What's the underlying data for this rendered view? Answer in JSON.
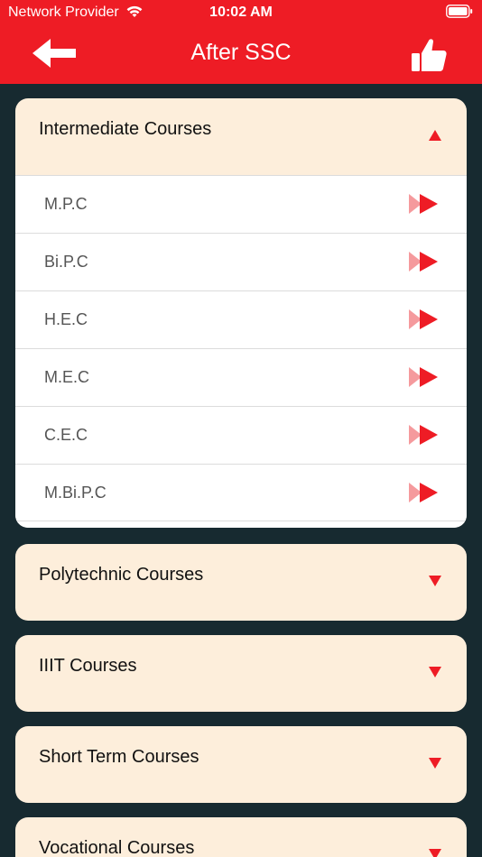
{
  "status_bar": {
    "carrier": "Network Provider",
    "time": "10:02 AM"
  },
  "nav": {
    "title": "After SSC",
    "back_icon": "back-arrow-icon",
    "like_icon": "thumbs-up-icon"
  },
  "colors": {
    "accent": "#ee1c25",
    "background": "#172a30",
    "card": "#fdeedb",
    "list": "#ffffff"
  },
  "sections": [
    {
      "title": "Intermediate Courses",
      "expanded": true,
      "items": [
        "M.P.C",
        "Bi.P.C",
        "H.E.C",
        "M.E.C",
        "C.E.C",
        "M.Bi.P.C"
      ]
    },
    {
      "title": "Polytechnic Courses",
      "expanded": false
    },
    {
      "title": "IIIT Courses",
      "expanded": false
    },
    {
      "title": "Short Term Courses",
      "expanded": false
    },
    {
      "title": "Vocational Courses",
      "expanded": false
    }
  ]
}
